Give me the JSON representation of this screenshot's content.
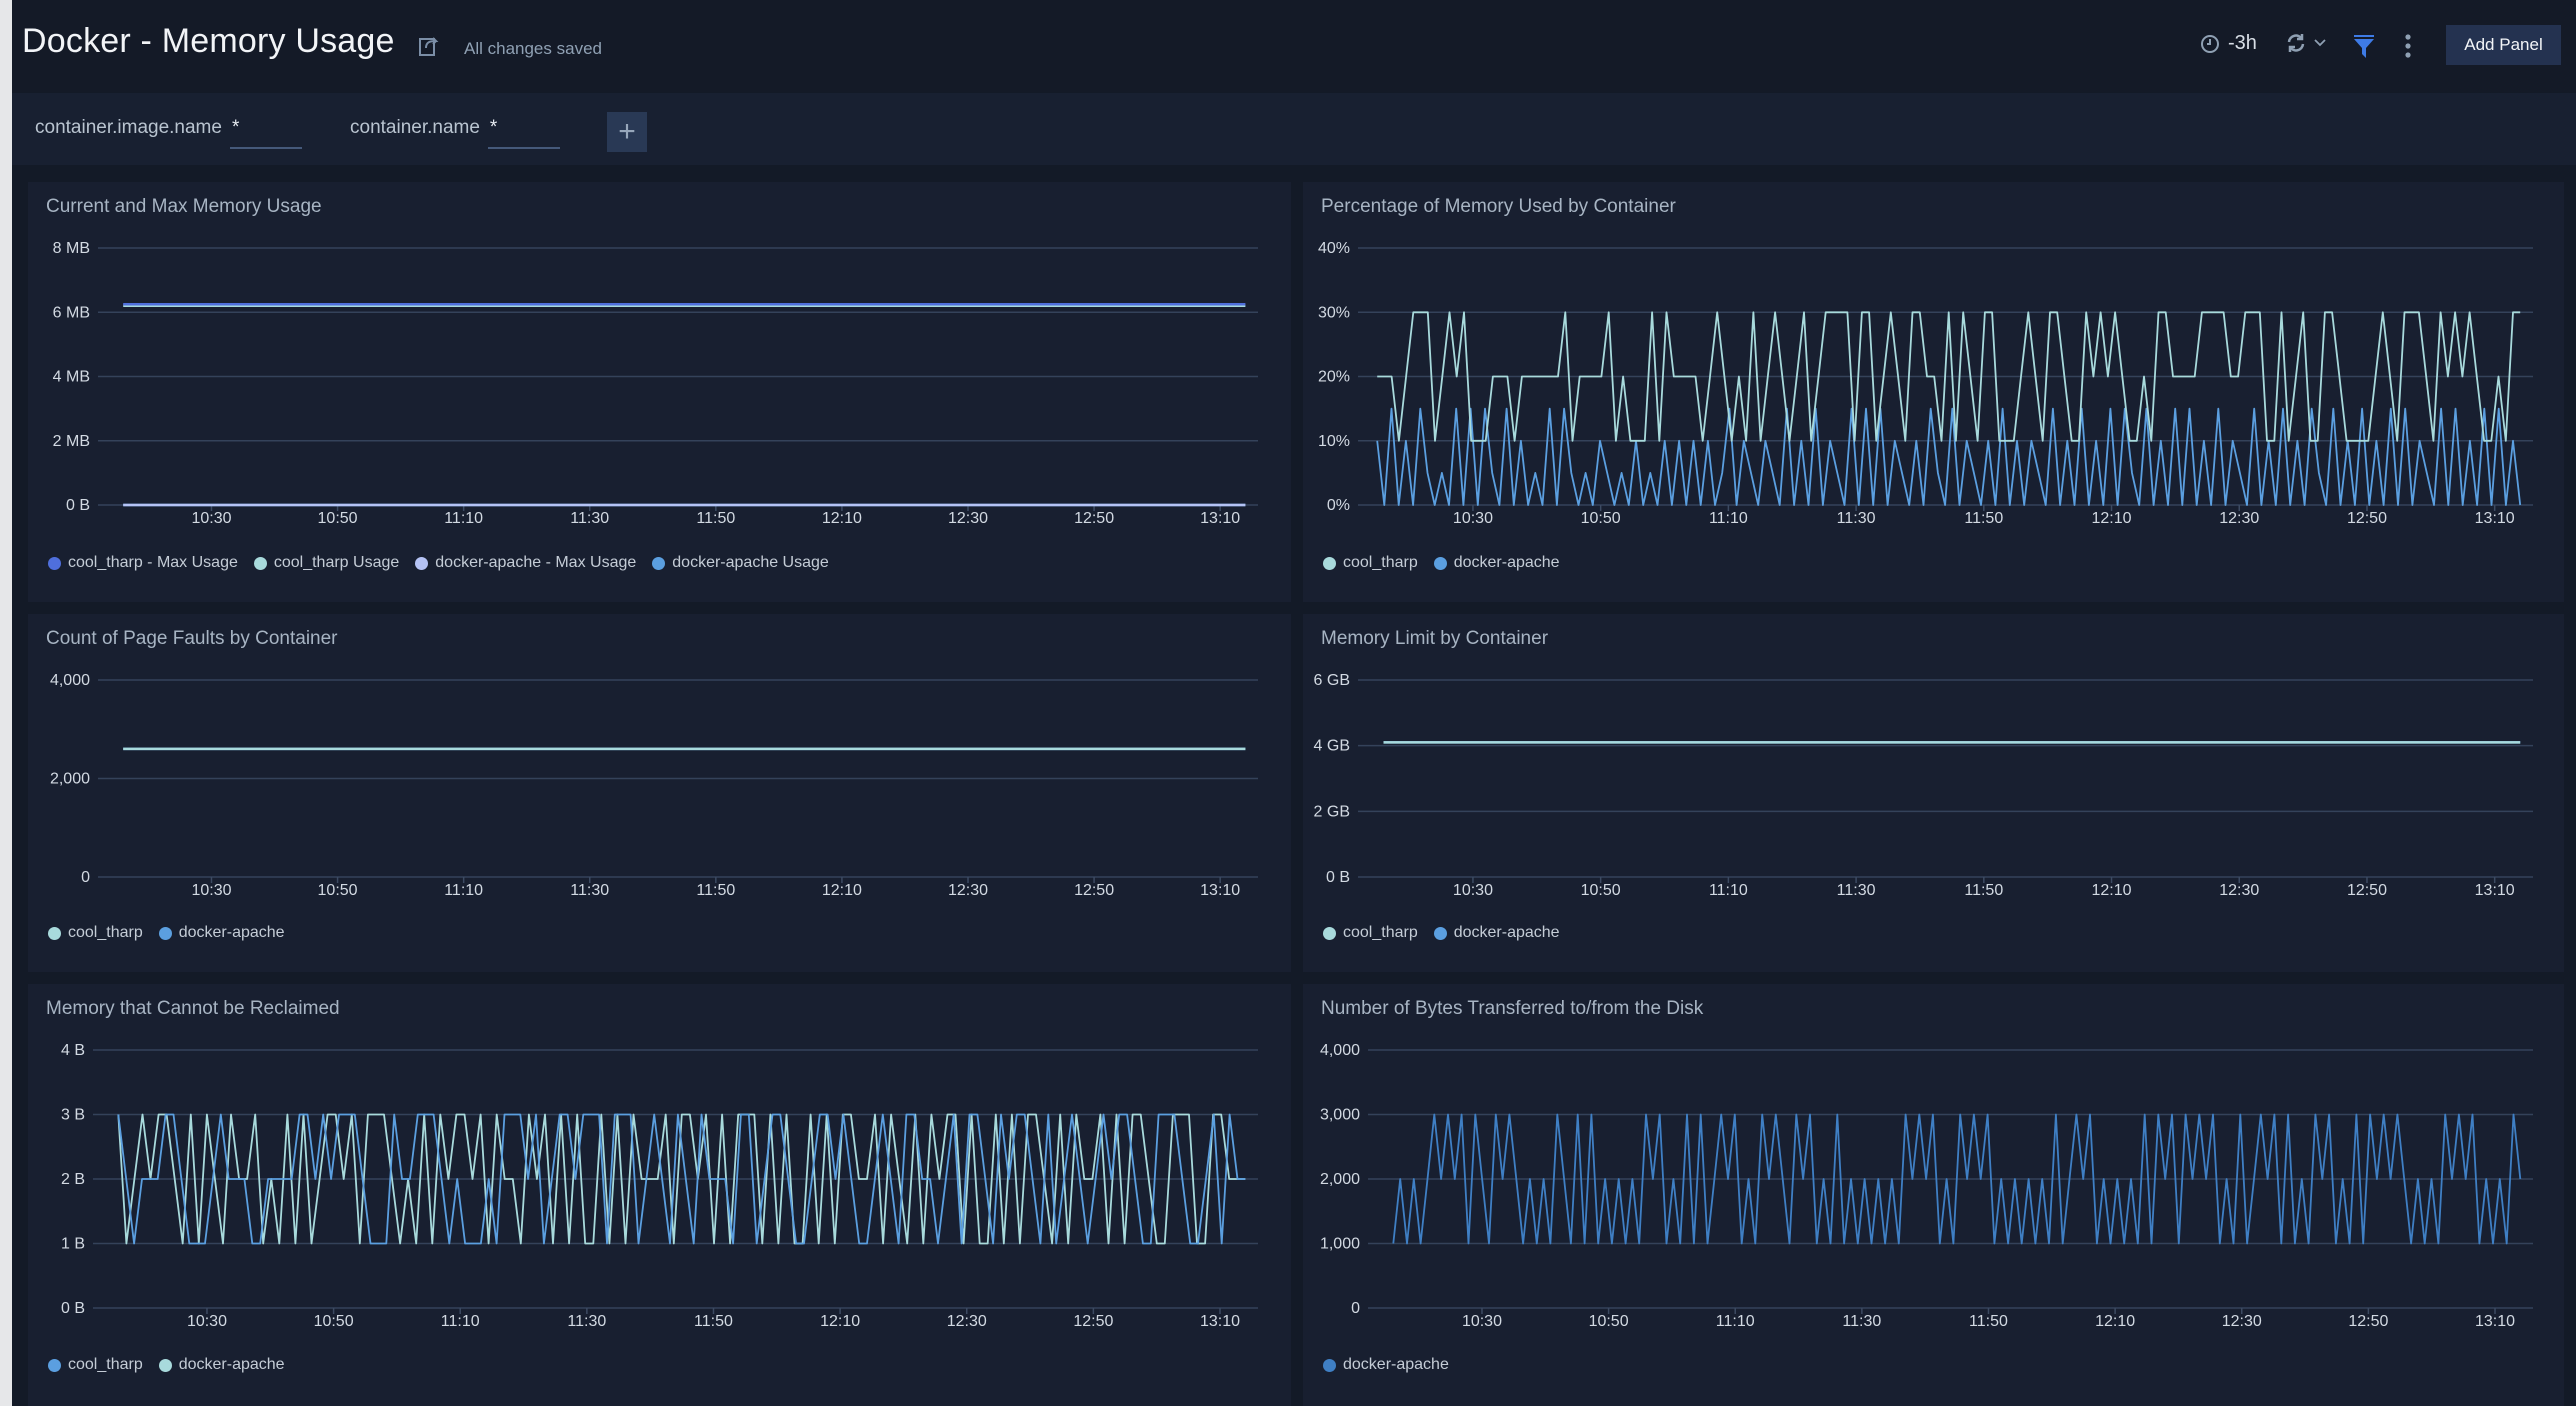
{
  "header": {
    "title": "Docker - Memory Usage",
    "save_status": "All changes saved",
    "time_range": "-3h",
    "add_panel_label": "Add Panel",
    "icons": [
      "share-icon",
      "clock-icon",
      "refresh-icon",
      "chevron-down-icon",
      "filter-icon",
      "more-vertical-icon"
    ]
  },
  "filters": [
    {
      "label": "container.image.name",
      "value": "*"
    },
    {
      "label": "container.name",
      "value": "*"
    }
  ],
  "add_filter_label": "+",
  "colors": {
    "cool_tharp": "#a8dadc",
    "docker_apache": "#5b9fe0",
    "max_cool": "#4f6fdc",
    "max_apache": "#b5c3f5",
    "accent": "#3e7be6"
  },
  "chart_data": [
    {
      "id": "mem-usage",
      "type": "line",
      "title": "Current and Max Memory Usage",
      "xlabel": "",
      "ylabel": "",
      "x_ticks": [
        "10:30",
        "10:50",
        "11:10",
        "11:30",
        "11:50",
        "12:10",
        "12:30",
        "12:50",
        "13:10"
      ],
      "y_ticks": [
        "0 B",
        "2 MB",
        "4 MB",
        "6 MB",
        "8 MB"
      ],
      "ylim": [
        0,
        8
      ],
      "y_unit": "MB",
      "x_range": [
        "10:16",
        "13:14"
      ],
      "grid": true,
      "legend": "bottom-left",
      "series": [
        {
          "name": "cool_tharp - Max Usage",
          "color": "#4f6fdc",
          "constant": 6.25
        },
        {
          "name": "cool_tharp Usage",
          "color": "#a8dadc",
          "constant": 6.2
        },
        {
          "name": "docker-apache - Max Usage",
          "color": "#b5c3f5",
          "constant": 0
        },
        {
          "name": "docker-apache Usage",
          "color": "#5b9fe0",
          "constant": 0
        }
      ]
    },
    {
      "id": "mem-pct",
      "type": "line",
      "title": "Percentage of Memory Used by Container",
      "xlabel": "",
      "ylabel": "",
      "x_ticks": [
        "10:30",
        "10:50",
        "11:10",
        "11:30",
        "11:50",
        "12:10",
        "12:30",
        "12:50",
        "13:10"
      ],
      "y_ticks": [
        "0%",
        "10%",
        "20%",
        "30%",
        "40%"
      ],
      "ylim": [
        0,
        40
      ],
      "y_unit": "%",
      "x_range": [
        "10:15",
        "13:14"
      ],
      "grid": true,
      "legend": "bottom-left",
      "series": [
        {
          "name": "cool_tharp",
          "color": "#a8dadc",
          "values": [
            20,
            20,
            20,
            10,
            20,
            30,
            30,
            30,
            10,
            20,
            30,
            20,
            30,
            10,
            10,
            10,
            20,
            20,
            20,
            10,
            20,
            20,
            20,
            20,
            20,
            20,
            30,
            10,
            20,
            20,
            20,
            20,
            30,
            10,
            20,
            10,
            10,
            10,
            30,
            10,
            30,
            20,
            20,
            20,
            20,
            10,
            20,
            30,
            20,
            10,
            20,
            10,
            30,
            10,
            20,
            30,
            20,
            10,
            20,
            30,
            10,
            20,
            30,
            30,
            30,
            30,
            10,
            30,
            30,
            10,
            20,
            30,
            20,
            10,
            30,
            30,
            20,
            20,
            10,
            30,
            10,
            30,
            20,
            10,
            30,
            30,
            10,
            10,
            10,
            20,
            30,
            20,
            10,
            30,
            30,
            20,
            10,
            10,
            30,
            20,
            30,
            20,
            30,
            20,
            10,
            10,
            20,
            10,
            30,
            30,
            20,
            20,
            20,
            20,
            30,
            30,
            30,
            30,
            20,
            20,
            30,
            30,
            30,
            10,
            10,
            30,
            10,
            20,
            30,
            10,
            10,
            30,
            30,
            20,
            10,
            10,
            10,
            10,
            20,
            30,
            20,
            10,
            30,
            30,
            30,
            20,
            10,
            30,
            20,
            30,
            20,
            30,
            20,
            10,
            10,
            20,
            10,
            30,
            30
          ]
        },
        {
          "name": "docker-apache",
          "color": "#5b9fe0",
          "values": [
            10,
            0,
            15,
            0,
            10,
            0,
            15,
            5,
            0,
            5,
            0,
            15,
            0,
            15,
            0,
            15,
            5,
            0,
            15,
            0,
            10,
            0,
            5,
            0,
            15,
            0,
            15,
            5,
            0,
            5,
            0,
            10,
            5,
            0,
            5,
            0,
            10,
            0,
            5,
            0,
            10,
            0,
            10,
            0,
            10,
            0,
            10,
            0,
            5,
            15,
            0,
            10,
            5,
            0,
            10,
            5,
            0,
            15,
            0,
            10,
            0,
            15,
            0,
            10,
            5,
            0,
            15,
            0,
            15,
            0,
            15,
            0,
            10,
            5,
            0,
            10,
            0,
            15,
            5,
            0,
            15,
            0,
            10,
            5,
            0,
            10,
            0,
            15,
            0,
            10,
            0,
            10,
            5,
            0,
            15,
            0,
            10,
            0,
            15,
            0,
            10,
            0,
            15,
            0,
            15,
            5,
            0,
            15,
            0,
            10,
            0,
            15,
            0,
            15,
            0,
            10,
            0,
            15,
            0,
            10,
            5,
            0,
            15,
            0,
            10,
            0,
            15,
            0,
            10,
            0,
            15,
            5,
            0,
            15,
            0,
            10,
            0,
            15,
            0,
            10,
            0,
            15,
            0,
            15,
            0,
            10,
            5,
            0,
            15,
            0,
            15,
            0,
            10,
            0,
            15,
            0,
            15,
            0,
            10,
            0
          ]
        }
      ]
    },
    {
      "id": "page-faults",
      "type": "line",
      "title": "Count of Page Faults by Container",
      "xlabel": "",
      "ylabel": "",
      "x_ticks": [
        "10:30",
        "10:50",
        "11:10",
        "11:30",
        "11:50",
        "12:10",
        "12:30",
        "12:50",
        "13:10"
      ],
      "y_ticks": [
        "0",
        "2,000",
        "4,000"
      ],
      "ylim": [
        0,
        4000
      ],
      "x_range": [
        "10:16",
        "13:14"
      ],
      "grid": true,
      "legend": "bottom-left",
      "series": [
        {
          "name": "cool_tharp",
          "color": "#a8dadc",
          "constant": 2600
        },
        {
          "name": "docker-apache",
          "color": "#5b9fe0",
          "constant": 2600
        }
      ]
    },
    {
      "id": "mem-limit",
      "type": "line",
      "title": "Memory Limit by Container",
      "xlabel": "",
      "ylabel": "",
      "x_ticks": [
        "10:30",
        "10:50",
        "11:10",
        "11:30",
        "11:50",
        "12:10",
        "12:30",
        "12:50",
        "13:10"
      ],
      "y_ticks": [
        "0 B",
        "2 GB",
        "4 GB",
        "6 GB"
      ],
      "ylim": [
        0,
        6
      ],
      "y_unit": "GB",
      "x_range": [
        "10:16",
        "13:14"
      ],
      "grid": true,
      "legend": "bottom-left",
      "series": [
        {
          "name": "cool_tharp",
          "color": "#a8dadc",
          "constant": 4.1
        },
        {
          "name": "docker-apache",
          "color": "#5b9fe0",
          "constant": 4.1
        }
      ]
    },
    {
      "id": "unreclaimable",
      "type": "line",
      "title": "Memory that Cannot be Reclaimed",
      "xlabel": "",
      "ylabel": "",
      "x_ticks": [
        "10:30",
        "10:50",
        "11:10",
        "11:30",
        "11:50",
        "12:10",
        "12:30",
        "12:50",
        "13:10"
      ],
      "y_ticks": [
        "0 B",
        "1 B",
        "2 B",
        "3 B",
        "4 B"
      ],
      "ylim": [
        0,
        4
      ],
      "y_unit": "B",
      "x_range": [
        "10:16",
        "13:14"
      ],
      "grid": true,
      "legend": "bottom-left",
      "series": [
        {
          "name": "cool_tharp",
          "color": "#5b9fe0",
          "values": [
            3,
            2,
            1,
            2,
            2,
            2,
            3,
            3,
            2,
            1,
            1,
            1,
            2,
            3,
            2,
            2,
            2,
            1,
            1,
            2,
            2,
            2,
            2,
            3,
            3,
            2,
            3,
            2,
            3,
            3,
            3,
            2,
            1,
            1,
            1,
            3,
            2,
            2,
            3,
            3,
            3,
            2,
            1,
            2,
            1,
            1,
            1,
            2,
            1,
            3,
            3,
            3,
            2,
            3,
            1,
            2,
            3,
            3,
            2,
            3,
            3,
            3,
            1,
            3,
            3,
            3,
            1,
            2,
            3,
            2,
            1,
            3,
            2,
            1,
            3,
            2,
            2,
            2,
            1,
            3,
            3,
            1,
            2,
            3,
            3,
            2,
            1,
            1,
            2,
            3,
            3,
            2,
            3,
            2,
            1,
            1,
            2,
            3,
            2,
            1,
            3,
            3,
            2,
            2,
            1,
            2,
            3,
            1,
            3,
            3,
            2,
            1,
            3,
            2,
            3,
            3,
            2,
            1,
            3,
            1,
            2,
            3,
            2,
            1,
            2,
            3,
            2,
            3,
            3,
            2,
            1,
            1,
            3,
            3,
            3,
            2,
            1,
            1,
            2,
            3,
            1,
            3,
            2,
            2
          ]
        },
        {
          "name": "docker-apache",
          "color": "#a8dadc",
          "values": [
            3,
            1,
            2,
            3,
            2,
            3,
            3,
            2,
            1,
            3,
            1,
            3,
            2,
            1,
            3,
            2,
            2,
            3,
            1,
            2,
            1,
            3,
            1,
            3,
            1,
            2,
            3,
            3,
            2,
            3,
            1,
            3,
            3,
            3,
            2,
            1,
            2,
            1,
            3,
            1,
            3,
            2,
            3,
            3,
            2,
            3,
            1,
            3,
            2,
            2,
            1,
            3,
            2,
            3,
            1,
            3,
            1,
            3,
            1,
            1,
            3,
            1,
            3,
            1,
            3,
            2,
            2,
            2,
            3,
            1,
            3,
            3,
            2,
            3,
            1,
            3,
            1,
            3,
            3,
            3,
            1,
            3,
            1,
            3,
            1,
            1,
            3,
            1,
            3,
            1,
            3,
            3,
            2,
            2,
            3,
            1,
            3,
            2,
            1,
            3,
            1,
            3,
            2,
            3,
            3,
            1,
            3,
            1,
            1,
            3,
            1,
            3,
            1,
            3,
            3,
            2,
            1,
            3,
            1,
            3,
            2,
            2,
            3,
            1,
            3,
            1,
            3,
            3,
            2,
            1,
            1,
            3,
            3,
            3,
            1,
            1,
            3,
            3,
            2,
            2,
            2
          ]
        }
      ]
    },
    {
      "id": "disk-bytes",
      "type": "line",
      "title": "Number of Bytes Transferred to/from the Disk",
      "xlabel": "",
      "ylabel": "",
      "x_ticks": [
        "10:30",
        "10:50",
        "11:10",
        "11:30",
        "11:50",
        "12:10",
        "12:30",
        "12:50",
        "13:10"
      ],
      "y_ticks": [
        "0",
        "1,000",
        "2,000",
        "3,000",
        "4,000"
      ],
      "ylim": [
        0,
        4000
      ],
      "x_range": [
        "10:16",
        "13:14"
      ],
      "grid": true,
      "legend": "bottom-left",
      "series": [
        {
          "name": "docker-apache",
          "color": "#3f7fc4",
          "values": [
            1000,
            2000,
            1000,
            2000,
            1000,
            2000,
            3000,
            2000,
            3000,
            2000,
            3000,
            1000,
            3000,
            2000,
            1000,
            3000,
            2000,
            3000,
            2000,
            1000,
            2000,
            1000,
            2000,
            1000,
            3000,
            2000,
            1000,
            3000,
            1000,
            3000,
            1000,
            2000,
            1000,
            2000,
            1000,
            2000,
            1000,
            3000,
            2000,
            3000,
            1000,
            2000,
            1000,
            3000,
            1000,
            3000,
            1000,
            2000,
            3000,
            2000,
            3000,
            1000,
            2000,
            1000,
            3000,
            2000,
            3000,
            2000,
            1000,
            3000,
            2000,
            3000,
            1000,
            2000,
            1000,
            3000,
            1000,
            2000,
            1000,
            2000,
            1000,
            2000,
            1000,
            2000,
            1000,
            3000,
            2000,
            3000,
            2000,
            3000,
            1000,
            2000,
            1000,
            3000,
            2000,
            3000,
            2000,
            3000,
            1000,
            2000,
            1000,
            2000,
            1000,
            2000,
            1000,
            2000,
            1000,
            3000,
            1000,
            2000,
            3000,
            2000,
            3000,
            1000,
            2000,
            1000,
            2000,
            1000,
            2000,
            1000,
            3000,
            1000,
            3000,
            2000,
            3000,
            1000,
            3000,
            2000,
            3000,
            2000,
            3000,
            1000,
            2000,
            1000,
            3000,
            1000,
            2000,
            3000,
            2000,
            3000,
            1000,
            3000,
            1000,
            2000,
            1000,
            3000,
            2000,
            3000,
            1000,
            2000,
            1000,
            3000,
            1000,
            3000,
            2000,
            3000,
            2000,
            3000,
            2000,
            1000,
            2000,
            1000,
            2000,
            1000,
            3000,
            2000,
            3000,
            2000,
            3000,
            1000,
            2000,
            1000,
            2000,
            1000,
            3000,
            2000
          ]
        }
      ]
    }
  ]
}
